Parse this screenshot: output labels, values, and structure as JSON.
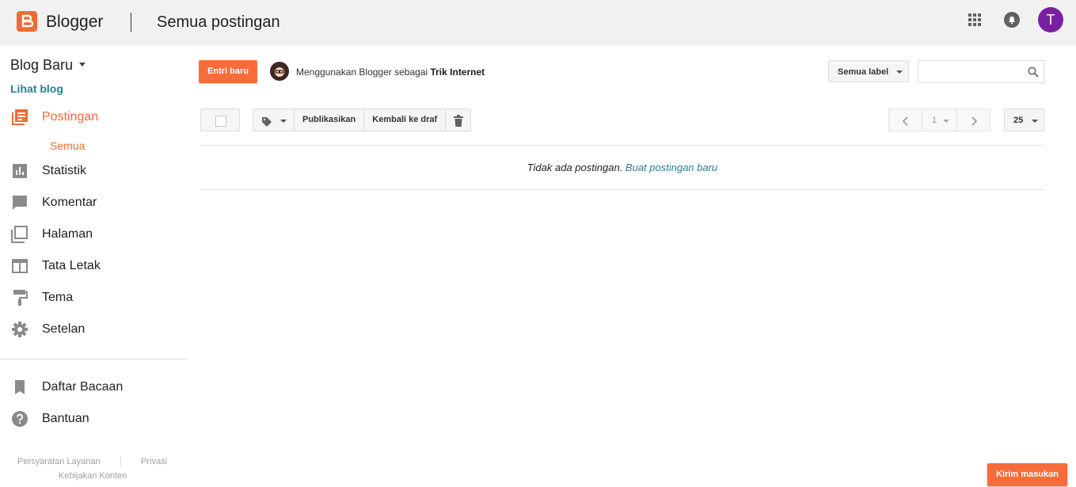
{
  "header": {
    "app_name": "Blogger",
    "page_title": "Semua postingan",
    "avatar_initial": "T",
    "avatar_color": "#7b1fa2",
    "brand_color": "#f06a35"
  },
  "sidebar": {
    "blog_name": "Blog Baru",
    "view_blog": "Lihat blog",
    "items": [
      {
        "label": "Postingan",
        "icon": "posts-icon"
      },
      {
        "label": "Statistik",
        "icon": "stats-icon"
      },
      {
        "label": "Komentar",
        "icon": "comments-icon"
      },
      {
        "label": "Halaman",
        "icon": "pages-icon"
      },
      {
        "label": "Tata Letak",
        "icon": "layout-icon"
      },
      {
        "label": "Tema",
        "icon": "theme-icon"
      },
      {
        "label": "Setelan",
        "icon": "settings-icon"
      }
    ],
    "sub_item": "Semua",
    "secondary": [
      {
        "label": "Daftar Bacaan",
        "icon": "bookmark-icon"
      },
      {
        "label": "Bantuan",
        "icon": "help-icon"
      }
    ],
    "footer": {
      "terms": "Persyaratan Layanan",
      "privacy": "Privasi",
      "content_policy": "Kebijakan Konten"
    }
  },
  "toolbar": {
    "new_post": "Entri baru",
    "using_prefix": "Menggunakan Blogger sebagai",
    "using_name": "Trik Internet",
    "label_filter": "Semua label",
    "publish": "Publikasikan",
    "revert_draft": "Kembali ke draf",
    "page": "1",
    "per_page": "25"
  },
  "posts": {
    "empty_message": "Tidak ada postingan.",
    "create_link": "Buat postingan baru"
  },
  "feedback": "Kirim masukan"
}
